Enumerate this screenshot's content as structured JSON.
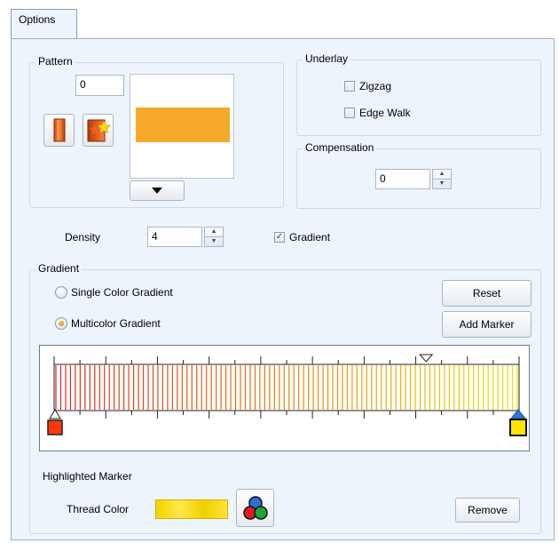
{
  "tab": {
    "label": "Options"
  },
  "pattern": {
    "title": "Pattern",
    "number": "0",
    "swatch_color": "#f6a829",
    "dropdown_icon": "triangle-down"
  },
  "underlay": {
    "title": "Underlay",
    "zigzag": {
      "label": "Zigzag",
      "checked": false
    },
    "edge_walk": {
      "label": "Edge Walk",
      "checked": false
    }
  },
  "compensation": {
    "title": "Compensation",
    "value": "0"
  },
  "density": {
    "label": "Density",
    "value": "4"
  },
  "gradient_toggle": {
    "label": "Gradient",
    "checked": true,
    "check_glyph": "✓"
  },
  "gradient": {
    "title": "Gradient",
    "single_color_label": "Single Color Gradient",
    "multicolor_label": "Multicolor Gradient",
    "selected": "multicolor",
    "reset_label": "Reset",
    "add_marker_label": "Add Marker",
    "start_marker_color": "#ff3a0a",
    "end_marker_color": "#ffe400",
    "marker_position_fraction": 0.8
  },
  "highlighted_marker": {
    "title": "Highlighted Marker",
    "thread_color_label": "Thread Color",
    "thread_color": "#f2d400",
    "remove_label": "Remove"
  }
}
